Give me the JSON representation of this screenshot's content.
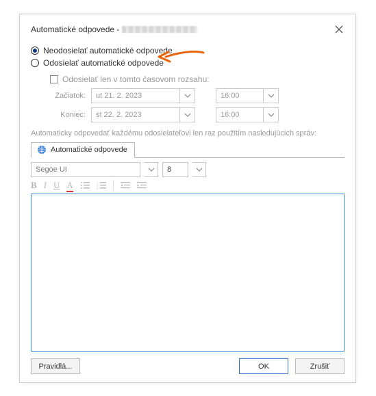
{
  "title": "Automatické odpovede -",
  "radio": {
    "off": "Neodosielať automatické odpovede",
    "on": "Odosielať automatické odpovede"
  },
  "timeRange": {
    "checkbox": "Odosielať len v tomto časovom rozsahu:",
    "startLabel": "Začiatok:",
    "endLabel": "Koniec:",
    "startDate": "ut 21. 2. 2023",
    "startTime": "16:00",
    "endDate": "st 22. 2. 2023",
    "endTime": "16:00"
  },
  "note": "Automaticky odpovedať každému odosielateľovi len raz použitím nasledujúcich správ:",
  "tab": "Automatické odpovede",
  "editor": {
    "font": "Segoe UI",
    "size": "8"
  },
  "buttons": {
    "rules": "Pravidlá...",
    "ok": "OK",
    "cancel": "Zrušiť"
  }
}
